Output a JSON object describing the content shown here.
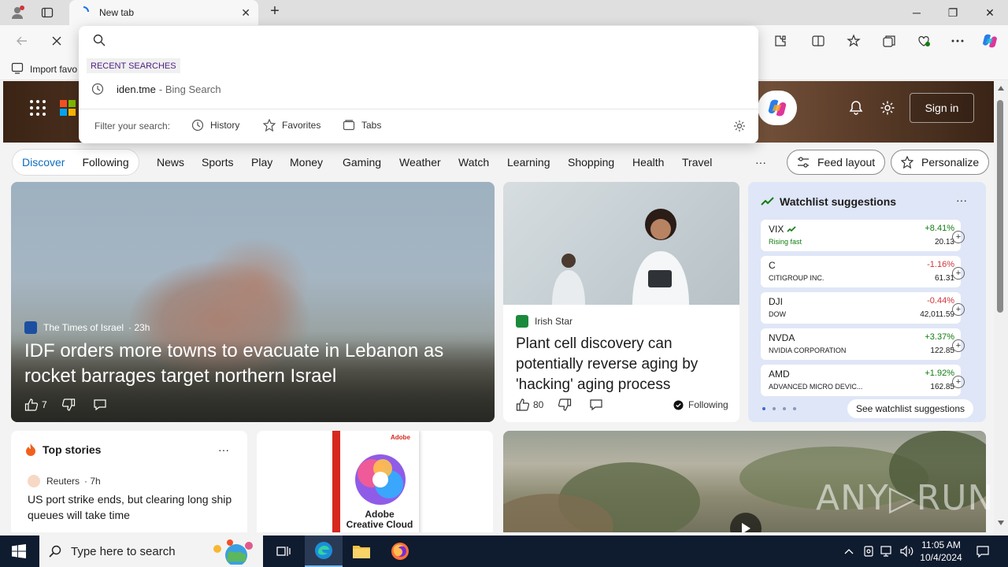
{
  "browser": {
    "tab_title": "New tab",
    "favorites_import": "Import favo"
  },
  "address_dropdown": {
    "section_label": "RECENT SEARCHES",
    "recent": [
      {
        "query": "iden.tme",
        "suffix": "- Bing Search"
      }
    ],
    "filter_label": "Filter your search:",
    "filters": [
      "History",
      "Favorites",
      "Tabs"
    ]
  },
  "header": {
    "sign_in": "Sign in"
  },
  "nav": {
    "discover": "Discover",
    "following": "Following",
    "items": [
      "News",
      "Sports",
      "Play",
      "Money",
      "Gaming",
      "Weather",
      "Watch",
      "Learning",
      "Shopping",
      "Health",
      "Travel"
    ],
    "more": "···",
    "feed_layout": "Feed layout",
    "personalize": "Personalize"
  },
  "main_story": {
    "source": "The Times of Israel",
    "age": "· 23h",
    "headline": "IDF orders more towns to evacuate in Lebanon as rocket barrages target northern Israel",
    "likes": "7"
  },
  "plant_story": {
    "source": "Irish Star",
    "headline": "Plant cell discovery can potentially reverse aging by 'hacking' aging process",
    "likes": "80",
    "following": "Following"
  },
  "watchlist": {
    "title": "Watchlist suggestions",
    "more": "···",
    "rows": [
      {
        "symbol": "VIX",
        "sub": "Rising fast",
        "change": "+8.41%",
        "price": "20.13",
        "up": true
      },
      {
        "symbol": "C",
        "sub": "CITIGROUP INC.",
        "change": "-1.16%",
        "price": "61.31",
        "up": false
      },
      {
        "symbol": "DJI",
        "sub": "DOW",
        "change": "-0.44%",
        "price": "42,011.59",
        "up": false
      },
      {
        "symbol": "NVDA",
        "sub": "NVIDIA CORPORATION",
        "change": "+3.37%",
        "price": "122.85",
        "up": true
      },
      {
        "symbol": "AMD",
        "sub": "ADVANCED MICRO DEVIC...",
        "change": "+1.92%",
        "price": "162.85",
        "up": true
      }
    ],
    "see_more": "See watchlist suggestions",
    "colors": {
      "up": "#107c10",
      "down": "#d13438",
      "rising": "#107c10"
    }
  },
  "top_stories": {
    "title": "Top stories",
    "more": "···",
    "source": "Reuters",
    "age": "· 7h",
    "headline": "US port strike ends, but clearing long ship queues will take time"
  },
  "adobe_ad": {
    "brand": "Adobe",
    "product_line1": "Adobe",
    "product_line2": "Creative Cloud"
  },
  "taskbar": {
    "search_placeholder": "Type here to search",
    "time": "11:05 AM",
    "date": "10/4/2024"
  },
  "watermark": "ANY▷RUN"
}
